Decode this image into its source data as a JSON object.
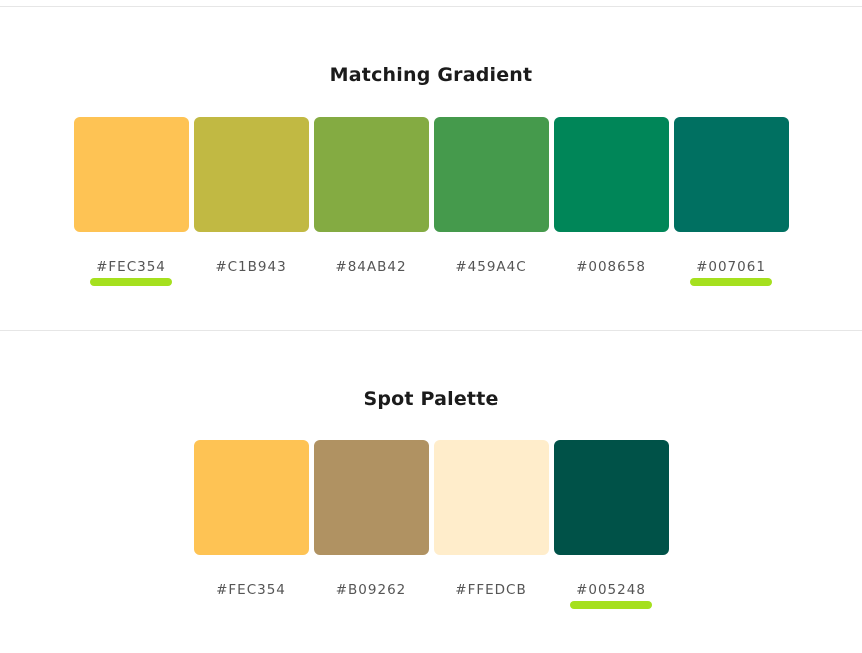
{
  "gradient": {
    "title": "Matching Gradient",
    "swatches": [
      {
        "hex": "#FEC354",
        "color": "#FEC354",
        "highlighted": true
      },
      {
        "hex": "#C1B943",
        "color": "#C1B943",
        "highlighted": false
      },
      {
        "hex": "#84AB42",
        "color": "#84AB42",
        "highlighted": false
      },
      {
        "hex": "#459A4C",
        "color": "#459A4C",
        "highlighted": false
      },
      {
        "hex": "#008658",
        "color": "#008658",
        "highlighted": false
      },
      {
        "hex": "#007061",
        "color": "#007061",
        "highlighted": true
      }
    ]
  },
  "spot": {
    "title": "Spot Palette",
    "swatches": [
      {
        "hex": "#FEC354",
        "color": "#FEC354",
        "highlighted": false
      },
      {
        "hex": "#B09262",
        "color": "#B09262",
        "highlighted": false
      },
      {
        "hex": "#FFEDCB",
        "color": "#FFEDCB",
        "highlighted": false
      },
      {
        "hex": "#005248",
        "color": "#005248",
        "highlighted": true
      }
    ]
  },
  "colors": {
    "highlight": "#A5E01E",
    "divider": "#E6E6E6",
    "title_text": "#1B1B1B",
    "hex_text": "#555555"
  }
}
